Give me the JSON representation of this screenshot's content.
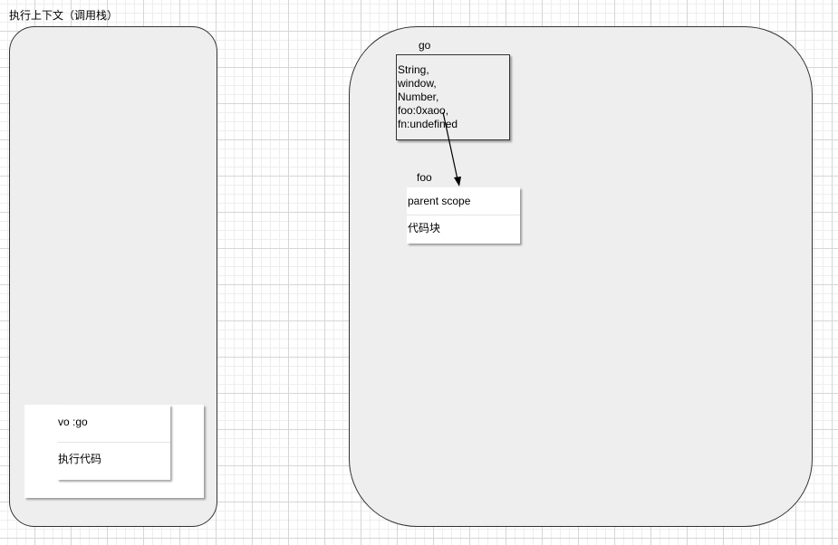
{
  "diagram": {
    "title": "执行上下文（调用栈）",
    "call_stack": {
      "frame": {
        "vo": "vo :go",
        "code": "执行代码"
      }
    },
    "heap": {
      "go": {
        "label": "go",
        "lines": [
          "String,",
          "window,",
          "Number,",
          "foo:0xaoo,",
          "fn:undefined"
        ]
      },
      "foo": {
        "label": "foo",
        "parent_scope": "parent scope",
        "code": "代码块"
      }
    }
  }
}
